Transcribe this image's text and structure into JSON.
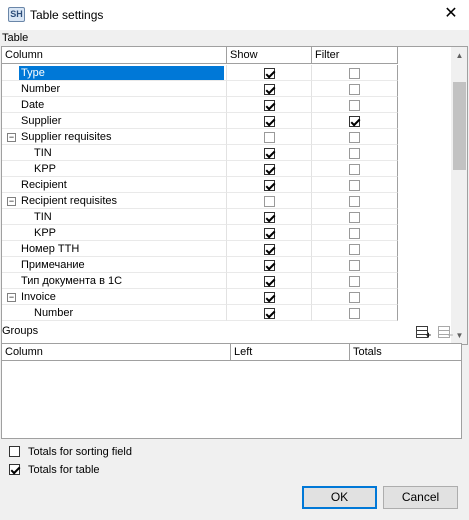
{
  "window": {
    "app_icon_text": "SH",
    "title": "Table settings",
    "close_label": "✕"
  },
  "table_section": {
    "label": "Table",
    "columns": {
      "column": "Column",
      "show": "Show",
      "filter": "Filter"
    },
    "rows": [
      {
        "label": "Type",
        "indent": 1,
        "expander": "",
        "show": true,
        "filter": false,
        "show_disabled": false,
        "filter_disabled": true,
        "selected": true
      },
      {
        "label": "Number",
        "indent": 1,
        "expander": "",
        "show": true,
        "filter": false,
        "show_disabled": false,
        "filter_disabled": true,
        "selected": false
      },
      {
        "label": "Date",
        "indent": 1,
        "expander": "",
        "show": true,
        "filter": false,
        "show_disabled": false,
        "filter_disabled": true,
        "selected": false
      },
      {
        "label": "Supplier",
        "indent": 1,
        "expander": "",
        "show": true,
        "filter": true,
        "show_disabled": false,
        "filter_disabled": false,
        "selected": false
      },
      {
        "label": "Supplier requisites",
        "indent": 1,
        "expander": "−",
        "show": false,
        "filter": false,
        "show_disabled": true,
        "filter_disabled": true,
        "selected": false
      },
      {
        "label": "TIN",
        "indent": 2,
        "expander": "",
        "show": true,
        "filter": false,
        "show_disabled": false,
        "filter_disabled": true,
        "selected": false
      },
      {
        "label": "KPP",
        "indent": 2,
        "expander": "",
        "show": true,
        "filter": false,
        "show_disabled": false,
        "filter_disabled": true,
        "selected": false
      },
      {
        "label": "Recipient",
        "indent": 1,
        "expander": "",
        "show": true,
        "filter": false,
        "show_disabled": false,
        "filter_disabled": true,
        "selected": false
      },
      {
        "label": "Recipient requisites",
        "indent": 1,
        "expander": "−",
        "show": false,
        "filter": false,
        "show_disabled": true,
        "filter_disabled": true,
        "selected": false
      },
      {
        "label": "TIN",
        "indent": 2,
        "expander": "",
        "show": true,
        "filter": false,
        "show_disabled": false,
        "filter_disabled": true,
        "selected": false
      },
      {
        "label": "KPP",
        "indent": 2,
        "expander": "",
        "show": true,
        "filter": false,
        "show_disabled": false,
        "filter_disabled": true,
        "selected": false
      },
      {
        "label": "Номер ТТН",
        "indent": 1,
        "expander": "",
        "show": true,
        "filter": false,
        "show_disabled": false,
        "filter_disabled": true,
        "selected": false
      },
      {
        "label": "Примечание",
        "indent": 1,
        "expander": "",
        "show": true,
        "filter": false,
        "show_disabled": false,
        "filter_disabled": true,
        "selected": false
      },
      {
        "label": "Тип документа в 1С",
        "indent": 1,
        "expander": "",
        "show": true,
        "filter": false,
        "show_disabled": false,
        "filter_disabled": true,
        "selected": false
      },
      {
        "label": "Invoice",
        "indent": 1,
        "expander": "−",
        "show": true,
        "filter": false,
        "show_disabled": false,
        "filter_disabled": true,
        "selected": false
      },
      {
        "label": "Number",
        "indent": 2,
        "expander": "",
        "show": true,
        "filter": false,
        "show_disabled": false,
        "filter_disabled": true,
        "selected": false
      }
    ],
    "scrollbar": {
      "up_glyph": "▲",
      "down_glyph": "▼"
    }
  },
  "groups_section": {
    "label": "Groups",
    "add_group_icon": "add-group-icon",
    "remove_group_icon": "remove-group-icon",
    "columns": {
      "column": "Column",
      "left": "Left",
      "totals": "Totals"
    }
  },
  "options": {
    "totals_for_sorting_field": {
      "label": "Totals for sorting field",
      "checked": false
    },
    "totals_for_table": {
      "label": "Totals for table",
      "checked": true
    }
  },
  "buttons": {
    "ok": "OK",
    "cancel": "Cancel"
  },
  "colors": {
    "selection": "#0078d7",
    "dialog_bg": "#f0f0f0",
    "default_button_border": "#0078d7"
  }
}
